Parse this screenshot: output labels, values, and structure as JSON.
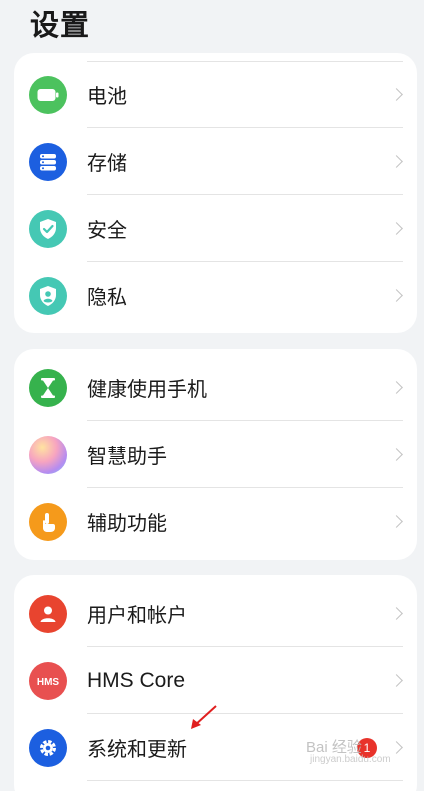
{
  "page": {
    "title": "设置"
  },
  "groups": [
    {
      "items": [
        {
          "label": "电池",
          "icon": "battery-icon",
          "color": "#4cc25e"
        },
        {
          "label": "存储",
          "icon": "storage-icon",
          "color": "#1c5fe0"
        },
        {
          "label": "安全",
          "icon": "shield-check-icon",
          "color": "#45c8b4"
        },
        {
          "label": "隐私",
          "icon": "privacy-shield-icon",
          "color": "#45c8b4"
        }
      ]
    },
    {
      "items": [
        {
          "label": "健康使用手机",
          "icon": "hourglass-icon",
          "color": "#36b24d"
        },
        {
          "label": "智慧助手",
          "icon": "assistant-orb-icon",
          "color": "#f27fa0"
        },
        {
          "label": "辅助功能",
          "icon": "hand-pointer-icon",
          "color": "#f59a1b"
        }
      ]
    },
    {
      "items": [
        {
          "label": "用户和帐户",
          "icon": "user-icon",
          "color": "#e8442f"
        },
        {
          "label": "HMS Core",
          "icon": "hms-icon",
          "color": "#e85050"
        },
        {
          "label": "系统和更新",
          "icon": "gear-icon",
          "color": "#1c5fe0",
          "badge": "1"
        }
      ]
    }
  ],
  "watermark": {
    "text": "Bai 经验",
    "sub": "jingyan.baidu.com"
  }
}
